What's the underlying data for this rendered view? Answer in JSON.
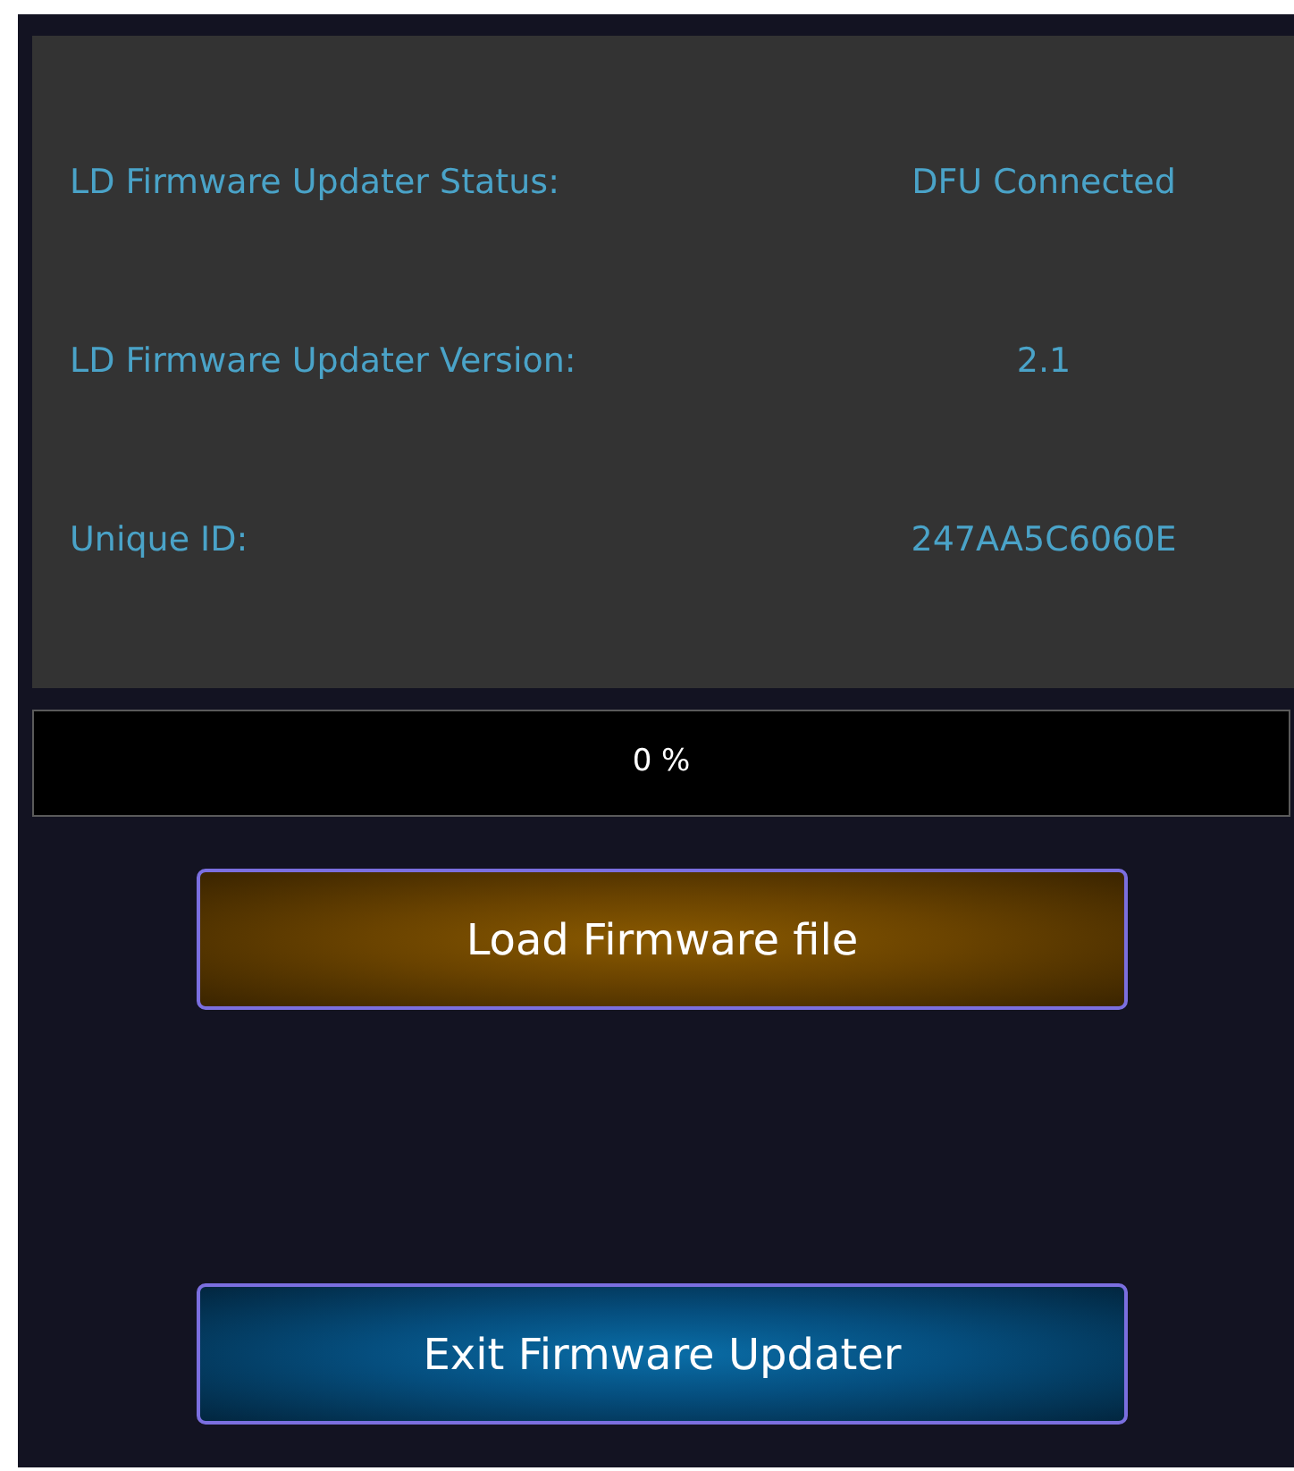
{
  "info_rows": [
    {
      "label": "LD Firmware Updater Status:",
      "value": "DFU Connected"
    },
    {
      "label": "LD Firmware Updater Version:",
      "value": "2.1"
    },
    {
      "label": "Unique ID:",
      "value": "247AA5C6060E"
    }
  ],
  "progress": {
    "level": 0,
    "reading": "0 %"
  },
  "buttons": [
    {
      "label": "Load Firmware file",
      "kind": "load"
    },
    {
      "label": "Exit Firmware Updater",
      "kind": "exit"
    }
  ]
}
